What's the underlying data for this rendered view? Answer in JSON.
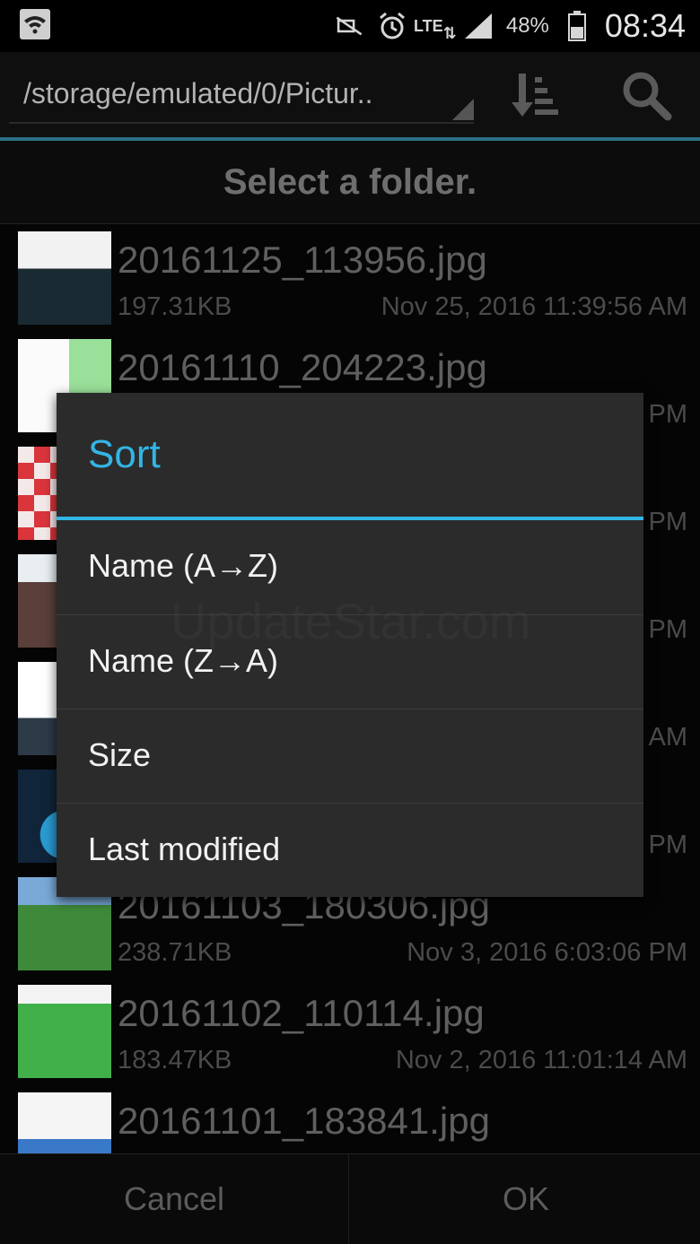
{
  "status_bar": {
    "battery_percent": "48%",
    "time": "08:34",
    "network_label": "LTE",
    "icons": [
      "wifi-icon",
      "mute-icon",
      "alarm-icon",
      "lte-icon",
      "signal-icon",
      "battery-icon"
    ]
  },
  "action_bar": {
    "path": "/storage/emulated/0/Pictur..",
    "sort_icon": "sort-icon",
    "search_icon": "search-icon"
  },
  "header": {
    "text": "Select a folder."
  },
  "files": [
    {
      "name": "20161125_113956.jpg",
      "size": "197.31KB",
      "date": "Nov 25, 2016 11:39:56 AM"
    },
    {
      "name": "20161110_204223.jpg",
      "size": "",
      "date": "PM"
    },
    {
      "name": "",
      "size": "",
      "date": "PM"
    },
    {
      "name": "",
      "size": "",
      "date": "PM"
    },
    {
      "name": "",
      "size": "",
      "date": "AM"
    },
    {
      "name": "",
      "size": "",
      "date": "PM"
    },
    {
      "name": "20161103_180306.jpg",
      "size": "238.71KB",
      "date": "Nov 3, 2016 6:03:06 PM"
    },
    {
      "name": "20161102_110114.jpg",
      "size": "183.47KB",
      "date": "Nov 2, 2016 11:01:14 AM"
    },
    {
      "name": "20161101_183841.jpg",
      "size": "",
      "date": ""
    }
  ],
  "dialog": {
    "title": "Sort",
    "options": [
      "Name (A→Z)",
      "Name (Z→A)",
      "Size",
      "Last modified"
    ]
  },
  "footer": {
    "cancel_label": "Cancel",
    "ok_label": "OK"
  },
  "watermark": "UpdateStar.com",
  "colors": {
    "accent": "#33b5e5",
    "dialog_bg": "#2b2b2b"
  }
}
